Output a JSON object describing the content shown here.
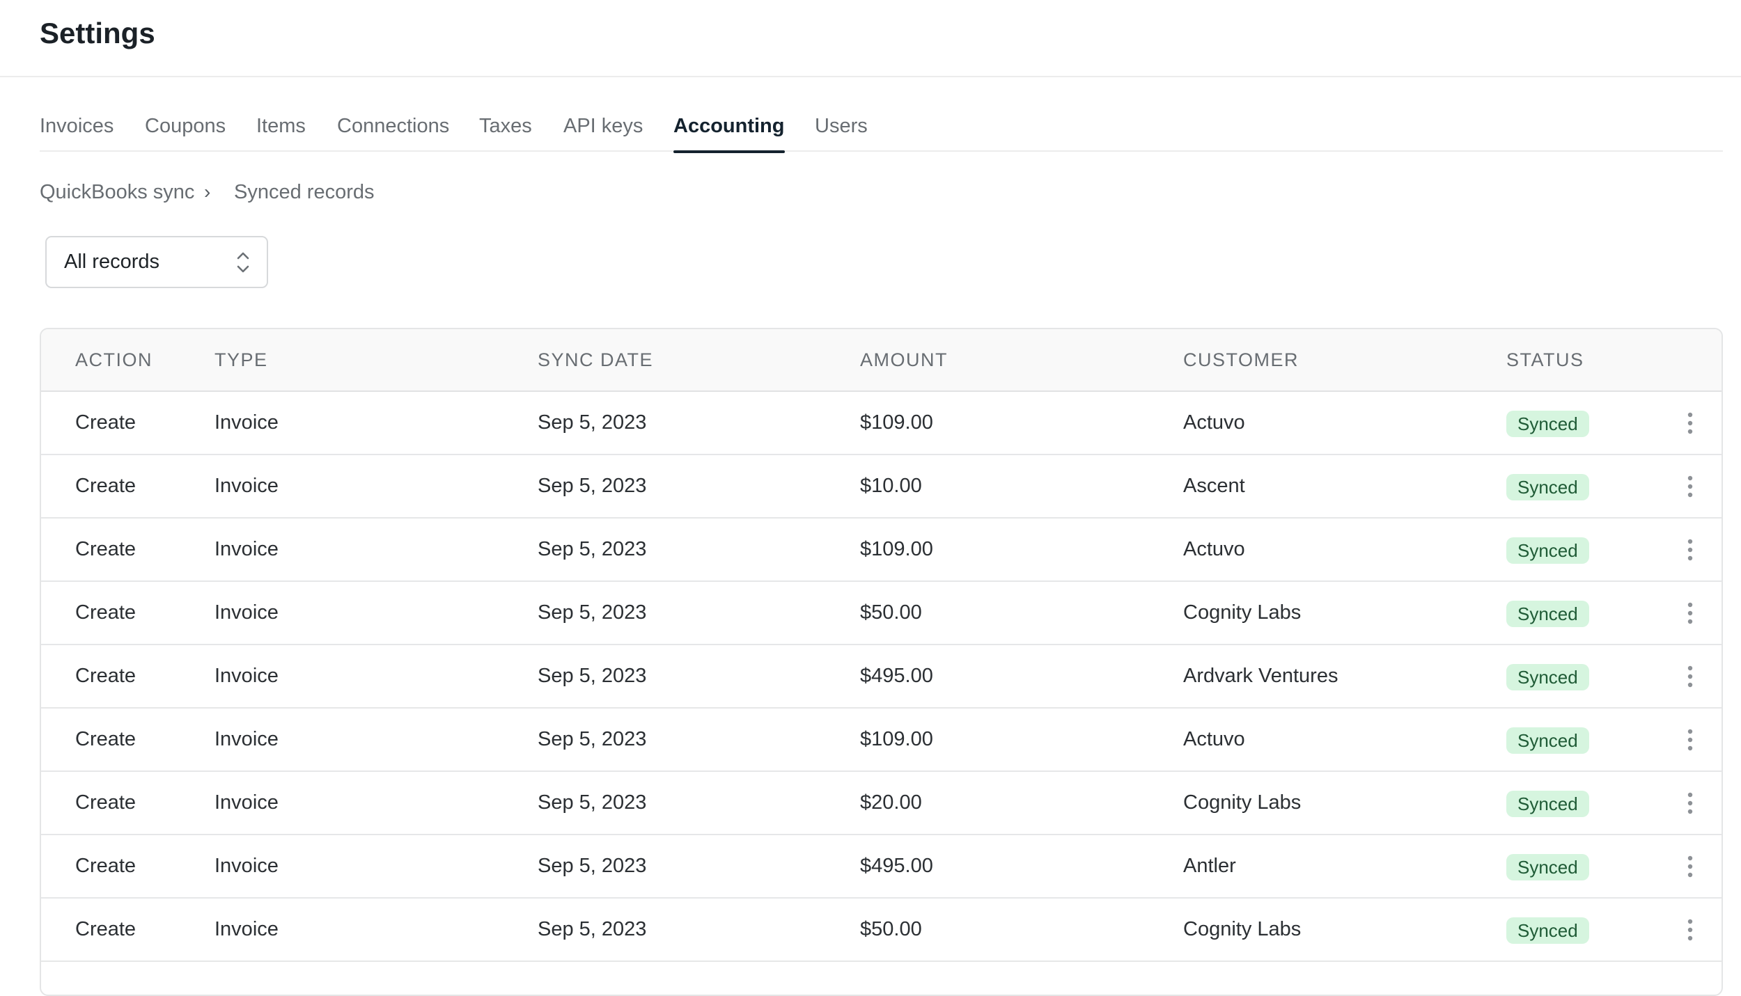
{
  "header": {
    "title": "Settings"
  },
  "tabs": [
    {
      "label": "Invoices",
      "active": false
    },
    {
      "label": "Coupons",
      "active": false
    },
    {
      "label": "Items",
      "active": false
    },
    {
      "label": "Connections",
      "active": false
    },
    {
      "label": "Taxes",
      "active": false
    },
    {
      "label": "API keys",
      "active": false
    },
    {
      "label": "Accounting",
      "active": true
    },
    {
      "label": "Users",
      "active": false
    }
  ],
  "breadcrumb": {
    "parent": "QuickBooks sync",
    "separator": "›",
    "current": "Synced records"
  },
  "filter": {
    "selected": "All records"
  },
  "table": {
    "columns": [
      "ACTION",
      "TYPE",
      "SYNC DATE",
      "AMOUNT",
      "CUSTOMER",
      "STATUS"
    ],
    "rows": [
      {
        "action": "Create",
        "type": "Invoice",
        "sync_date": "Sep 5, 2023",
        "amount": "$109.00",
        "customer": "Actuvo",
        "status": "Synced"
      },
      {
        "action": "Create",
        "type": "Invoice",
        "sync_date": "Sep 5, 2023",
        "amount": "$10.00",
        "customer": "Ascent",
        "status": "Synced"
      },
      {
        "action": "Create",
        "type": "Invoice",
        "sync_date": "Sep 5, 2023",
        "amount": "$109.00",
        "customer": "Actuvo",
        "status": "Synced"
      },
      {
        "action": "Create",
        "type": "Invoice",
        "sync_date": "Sep 5, 2023",
        "amount": "$50.00",
        "customer": "Cognity Labs",
        "status": "Synced"
      },
      {
        "action": "Create",
        "type": "Invoice",
        "sync_date": "Sep 5, 2023",
        "amount": "$495.00",
        "customer": "Ardvark Ventures",
        "status": "Synced"
      },
      {
        "action": "Create",
        "type": "Invoice",
        "sync_date": "Sep 5, 2023",
        "amount": "$109.00",
        "customer": "Actuvo",
        "status": "Synced"
      },
      {
        "action": "Create",
        "type": "Invoice",
        "sync_date": "Sep 5, 2023",
        "amount": "$20.00",
        "customer": "Cognity Labs",
        "status": "Synced"
      },
      {
        "action": "Create",
        "type": "Invoice",
        "sync_date": "Sep 5, 2023",
        "amount": "$495.00",
        "customer": "Antler",
        "status": "Synced"
      },
      {
        "action": "Create",
        "type": "Invoice",
        "sync_date": "Sep 5, 2023",
        "amount": "$50.00",
        "customer": "Cognity Labs",
        "status": "Synced"
      },
      {
        "action": "",
        "type": "",
        "sync_date": "",
        "amount": "",
        "customer": "",
        "status": ""
      }
    ]
  },
  "icons": {
    "breadcrumb_separator": "chevron-right-icon",
    "select_indicator": "chevron-up-down-icon",
    "row_menu": "more-vertical-icon"
  },
  "colors": {
    "text_primary": "#1b2127",
    "text_muted": "#686d72",
    "tab_active_underline": "#14222e",
    "badge_bg": "#d6f5df",
    "badge_text": "#1f5b36",
    "border": "#e4e5e6"
  }
}
